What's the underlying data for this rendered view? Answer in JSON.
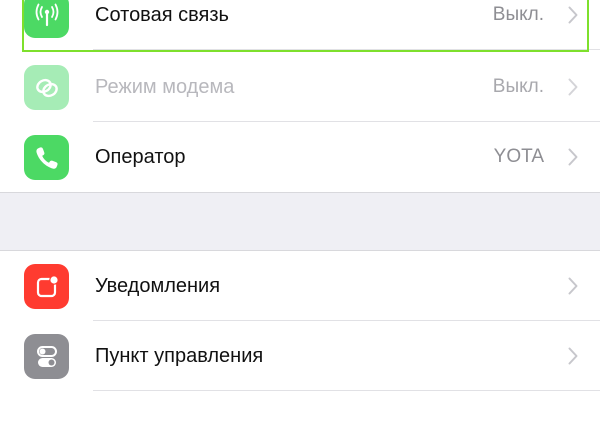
{
  "settings": {
    "group1": [
      {
        "label": "Сотовая связь",
        "value": "Выкл.",
        "icon": "antenna-icon",
        "color": "#4cd964",
        "disabled": false,
        "highlighted": true
      },
      {
        "label": "Режим модема",
        "value": "Выкл.",
        "icon": "chain-link-icon",
        "color": "#a6ecb6",
        "disabled": true
      },
      {
        "label": "Оператор",
        "value": "YOTA",
        "icon": "phone-icon",
        "color": "#4cd964",
        "disabled": false
      }
    ],
    "group2": [
      {
        "label": "Уведомления",
        "value": "",
        "icon": "notifications-icon",
        "color": "#ff3b30"
      },
      {
        "label": "Пункт управления",
        "value": "",
        "icon": "toggles-icon",
        "color": "#8e8e93"
      }
    ]
  },
  "colors": {
    "highlight": "#7ee02c",
    "background": "#efeff4"
  }
}
